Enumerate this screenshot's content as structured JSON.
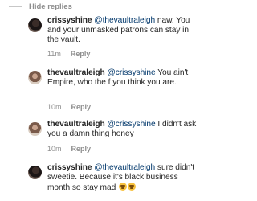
{
  "thread": {
    "hide_replies_label": "Hide replies"
  },
  "comments": [
    {
      "username": "crissyshine",
      "mention": "@thevaultraleigh",
      "body": " naw. You and your unmasked patrons can stay in the vault.",
      "time": "11m",
      "reply_label": "Reply"
    },
    {
      "username": "thevaultraleigh",
      "mention": "@crissyshine",
      "body": " You ain't Empire, who the f you think you are.",
      "time": "10m",
      "reply_label": "Reply"
    },
    {
      "username": "thevaultraleigh",
      "mention": "@crissyshine",
      "body": " I didn't ask you a damn thing honey",
      "time": "10m",
      "reply_label": "Reply"
    },
    {
      "username": "crissyshine",
      "mention": "@thevaultraleigh",
      "body": " sure didn't sweetie. Because it's black business month so stay mad",
      "emoji": [
        "grimacing-face-emoji",
        "grimacing-face-emoji"
      ],
      "time": "",
      "reply_label": ""
    }
  ]
}
